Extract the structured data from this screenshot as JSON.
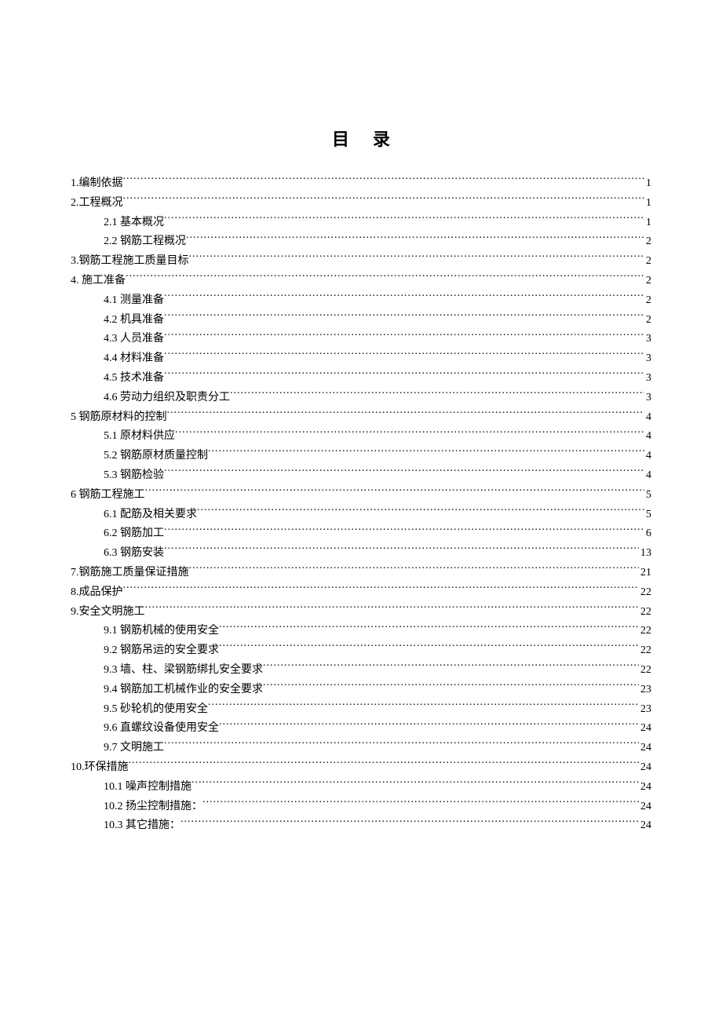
{
  "title": "目录",
  "toc": [
    {
      "level": 1,
      "label": "1.编制依据",
      "page": "1"
    },
    {
      "level": 1,
      "label": "2.工程概况",
      "page": "1"
    },
    {
      "level": 2,
      "label": "2.1 基本概况",
      "page": "1"
    },
    {
      "level": 2,
      "label": "2.2 钢筋工程概况",
      "page": "2"
    },
    {
      "level": 1,
      "label": "3.钢筋工程施工质量目标",
      "page": "2"
    },
    {
      "level": 1,
      "label": "4. 施工准备",
      "page": "2"
    },
    {
      "level": 2,
      "label": "4.1 测量准备",
      "page": "2"
    },
    {
      "level": 2,
      "label": "4.2 机具准备",
      "page": "2"
    },
    {
      "level": 2,
      "label": "4.3 人员准备",
      "page": "3"
    },
    {
      "level": 2,
      "label": "4.4 材料准备",
      "page": "3"
    },
    {
      "level": 2,
      "label": "4.5 技术准备",
      "page": "3"
    },
    {
      "level": 2,
      "label": "4.6 劳动力组织及职责分工",
      "page": "3"
    },
    {
      "level": 1,
      "label": "5 钢筋原材料的控制",
      "page": "4"
    },
    {
      "level": 2,
      "label": "5.1 原材料供应",
      "page": "4"
    },
    {
      "level": 2,
      "label": "5.2 钢筋原材质量控制",
      "page": "4"
    },
    {
      "level": 2,
      "label": "5.3 钢筋检验",
      "page": "4"
    },
    {
      "level": 1,
      "label": "6 钢筋工程施工",
      "page": "5"
    },
    {
      "level": 2,
      "label": "6.1 配筋及相关要求",
      "page": "5"
    },
    {
      "level": 2,
      "label": "6.2 钢筋加工",
      "page": " 6"
    },
    {
      "level": 2,
      "label": "6.3 钢筋安装",
      "page": "13"
    },
    {
      "level": 1,
      "label": "7.钢筋施工质量保证措施",
      "page": "21"
    },
    {
      "level": 1,
      "label": "8.成品保护",
      "page": "22"
    },
    {
      "level": 1,
      "label": "9.安全文明施工",
      "page": "22"
    },
    {
      "level": 2,
      "label": "9.1 钢筋机械的使用安全",
      "page": "22"
    },
    {
      "level": 2,
      "label": "9.2 钢筋吊运的安全要求",
      "page": "22"
    },
    {
      "level": 2,
      "label": "9.3 墙、柱、梁钢筋绑扎安全要求",
      "page": "22"
    },
    {
      "level": 2,
      "label": "9.4 钢筋加工机械作业的安全要求",
      "page": "23"
    },
    {
      "level": 2,
      "label": "9.5 砂轮机的使用安全",
      "page": "23"
    },
    {
      "level": 2,
      "label": "9.6 直螺纹设备使用安全",
      "page": "24"
    },
    {
      "level": 2,
      "label": "9.7 文明施工",
      "page": "24"
    },
    {
      "level": 1,
      "label": "10.环保措施",
      "page": "24"
    },
    {
      "level": 2,
      "label": "10.1 噪声控制措施",
      "page": "24"
    },
    {
      "level": 2,
      "label": "10.2 扬尘控制措施：",
      "page": "24"
    },
    {
      "level": 2,
      "label": "10.3 其它措施：",
      "page": "24"
    }
  ]
}
